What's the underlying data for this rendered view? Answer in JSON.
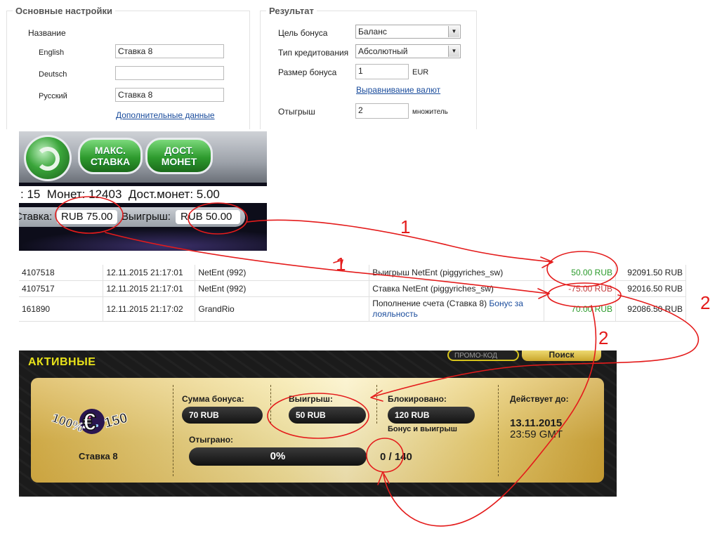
{
  "basic_settings": {
    "legend": "Основные настройки",
    "name_label": "Название",
    "rows": [
      {
        "label": "English",
        "value": "Ставка 8"
      },
      {
        "label": "Deutsch",
        "value": ""
      },
      {
        "label": "Русский",
        "value": "Ставка 8"
      }
    ],
    "extra_link": "Дополнительные данные"
  },
  "result": {
    "legend": "Результат",
    "bonus_target_label": "Цель бонуса",
    "bonus_target_value": "Баланс",
    "credit_type_label": "Тип кредитования",
    "credit_type_value": "Абсолютный",
    "bonus_size_label": "Размер бонуса",
    "bonus_size_value": "1",
    "bonus_size_unit": "EUR",
    "currency_link": "Выравнивание валют",
    "wager_label": "Отыгрыш",
    "wager_value": "2",
    "wager_unit": "множитель"
  },
  "game": {
    "max_bet": "МАКС. СТАВКА",
    "coin_value": "ДОСТ. МОНЕТ",
    "info_line": ": 15  Монет: 12403  Дост.монет: 5.00",
    "bet_label": "Ставка:",
    "bet_value": "RUB 75.00",
    "win_label": "Выигрыш:",
    "win_value": "RUB 50.00"
  },
  "transactions": [
    {
      "id": "4107518",
      "date": "12.11.2015 21:17:01",
      "provider": "NetEnt (992)",
      "desc": "Выигрыш NetEnt (piggyriches_sw)",
      "link": "",
      "amount": "50.00 RUB",
      "balance": "92091.50 RUB",
      "negative": false
    },
    {
      "id": "4107517",
      "date": "12.11.2015 21:17:01",
      "provider": "NetEnt (992)",
      "desc": "Ставка NetEnt (piggyriches_sw)",
      "link": "",
      "amount": "-75.00 RUB",
      "balance": "92016.50 RUB",
      "negative": true
    },
    {
      "id": "161890",
      "date": "12.11.2015 21:17:02",
      "provider": "GrandRio",
      "desc": "Пополнение счета (Ставка 8)",
      "link": "Бонус за лояльность",
      "amount": "70.00 RUB",
      "balance": "92086.50 RUB",
      "negative": false
    }
  ],
  "bonus": {
    "active_title": "АКТИВНЫЕ",
    "promo_placeholder": "ПРОМО-КОД",
    "search_label": "Поиск",
    "logo_text_percent": "100%",
    "logo_text_amount": "150",
    "name": "Ставка 8",
    "bonus_sum_label": "Сумма бонуса:",
    "bonus_sum_value": "70 RUB",
    "winnings_label": "Выигрыш:",
    "winnings_value": "50 RUB",
    "blocked_label": "Блокировано:",
    "blocked_value": "120 RUB",
    "blocked_note": "Бонус и выигрыш",
    "valid_label": "Действует до:",
    "valid_date": "13.11.2015",
    "valid_time": "23:59 GMT",
    "wagered_label": "Отыграно:",
    "progress_percent": 0,
    "progress_text": "0%",
    "progress_count": "0 / 140"
  },
  "annotations": {
    "color": "#e41b1b",
    "numbers": [
      "1",
      "1",
      "2",
      "2"
    ]
  }
}
